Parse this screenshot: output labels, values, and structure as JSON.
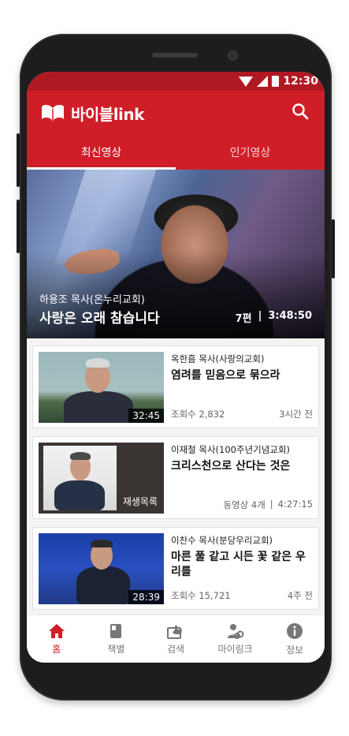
{
  "status_bar": {
    "time": "12:30"
  },
  "app": {
    "name": "바이블link"
  },
  "tabs": [
    {
      "label": "최신영상",
      "active": true
    },
    {
      "label": "인기영상",
      "active": false
    }
  ],
  "hero": {
    "pastor": "하용조 목사(온누리교회)",
    "title": "사랑은 오래 참습니다",
    "episodes": "7편",
    "separator": "|",
    "duration": "3:48:50"
  },
  "videos": [
    {
      "pastor": "옥한흠 목사(사랑의교회)",
      "title": "염려를 믿음으로 묶으라",
      "views": "조회수 2,832",
      "time_ago": "3시간 전",
      "duration": "32:45"
    },
    {
      "pastor": "이재철 목사(100주년기념교회)",
      "title": "크리스천으로 산다는 것은",
      "thumb_label": "재생목록",
      "video_count": "동영상 4개",
      "separator": "|",
      "total_duration": "4:27:15"
    },
    {
      "pastor": "이찬수 목사(분당우리교회)",
      "title": "마른 풀 같고 시든 꽃 같은 우리를",
      "views": "조회수 15,721",
      "time_ago": "4주 전",
      "duration": "28:39"
    }
  ],
  "bottom_nav": [
    {
      "label": "홈",
      "icon": "home-icon",
      "active": true
    },
    {
      "label": "책별",
      "icon": "book-icon",
      "active": false
    },
    {
      "label": "검색",
      "icon": "search-thumb-icon",
      "active": false
    },
    {
      "label": "마이링크",
      "icon": "my-link-icon",
      "active": false
    },
    {
      "label": "정보",
      "icon": "info-icon",
      "active": false
    }
  ],
  "colors": {
    "primary": "#d01e28",
    "status_bar": "#b01922",
    "nav_inactive": "#777777"
  }
}
